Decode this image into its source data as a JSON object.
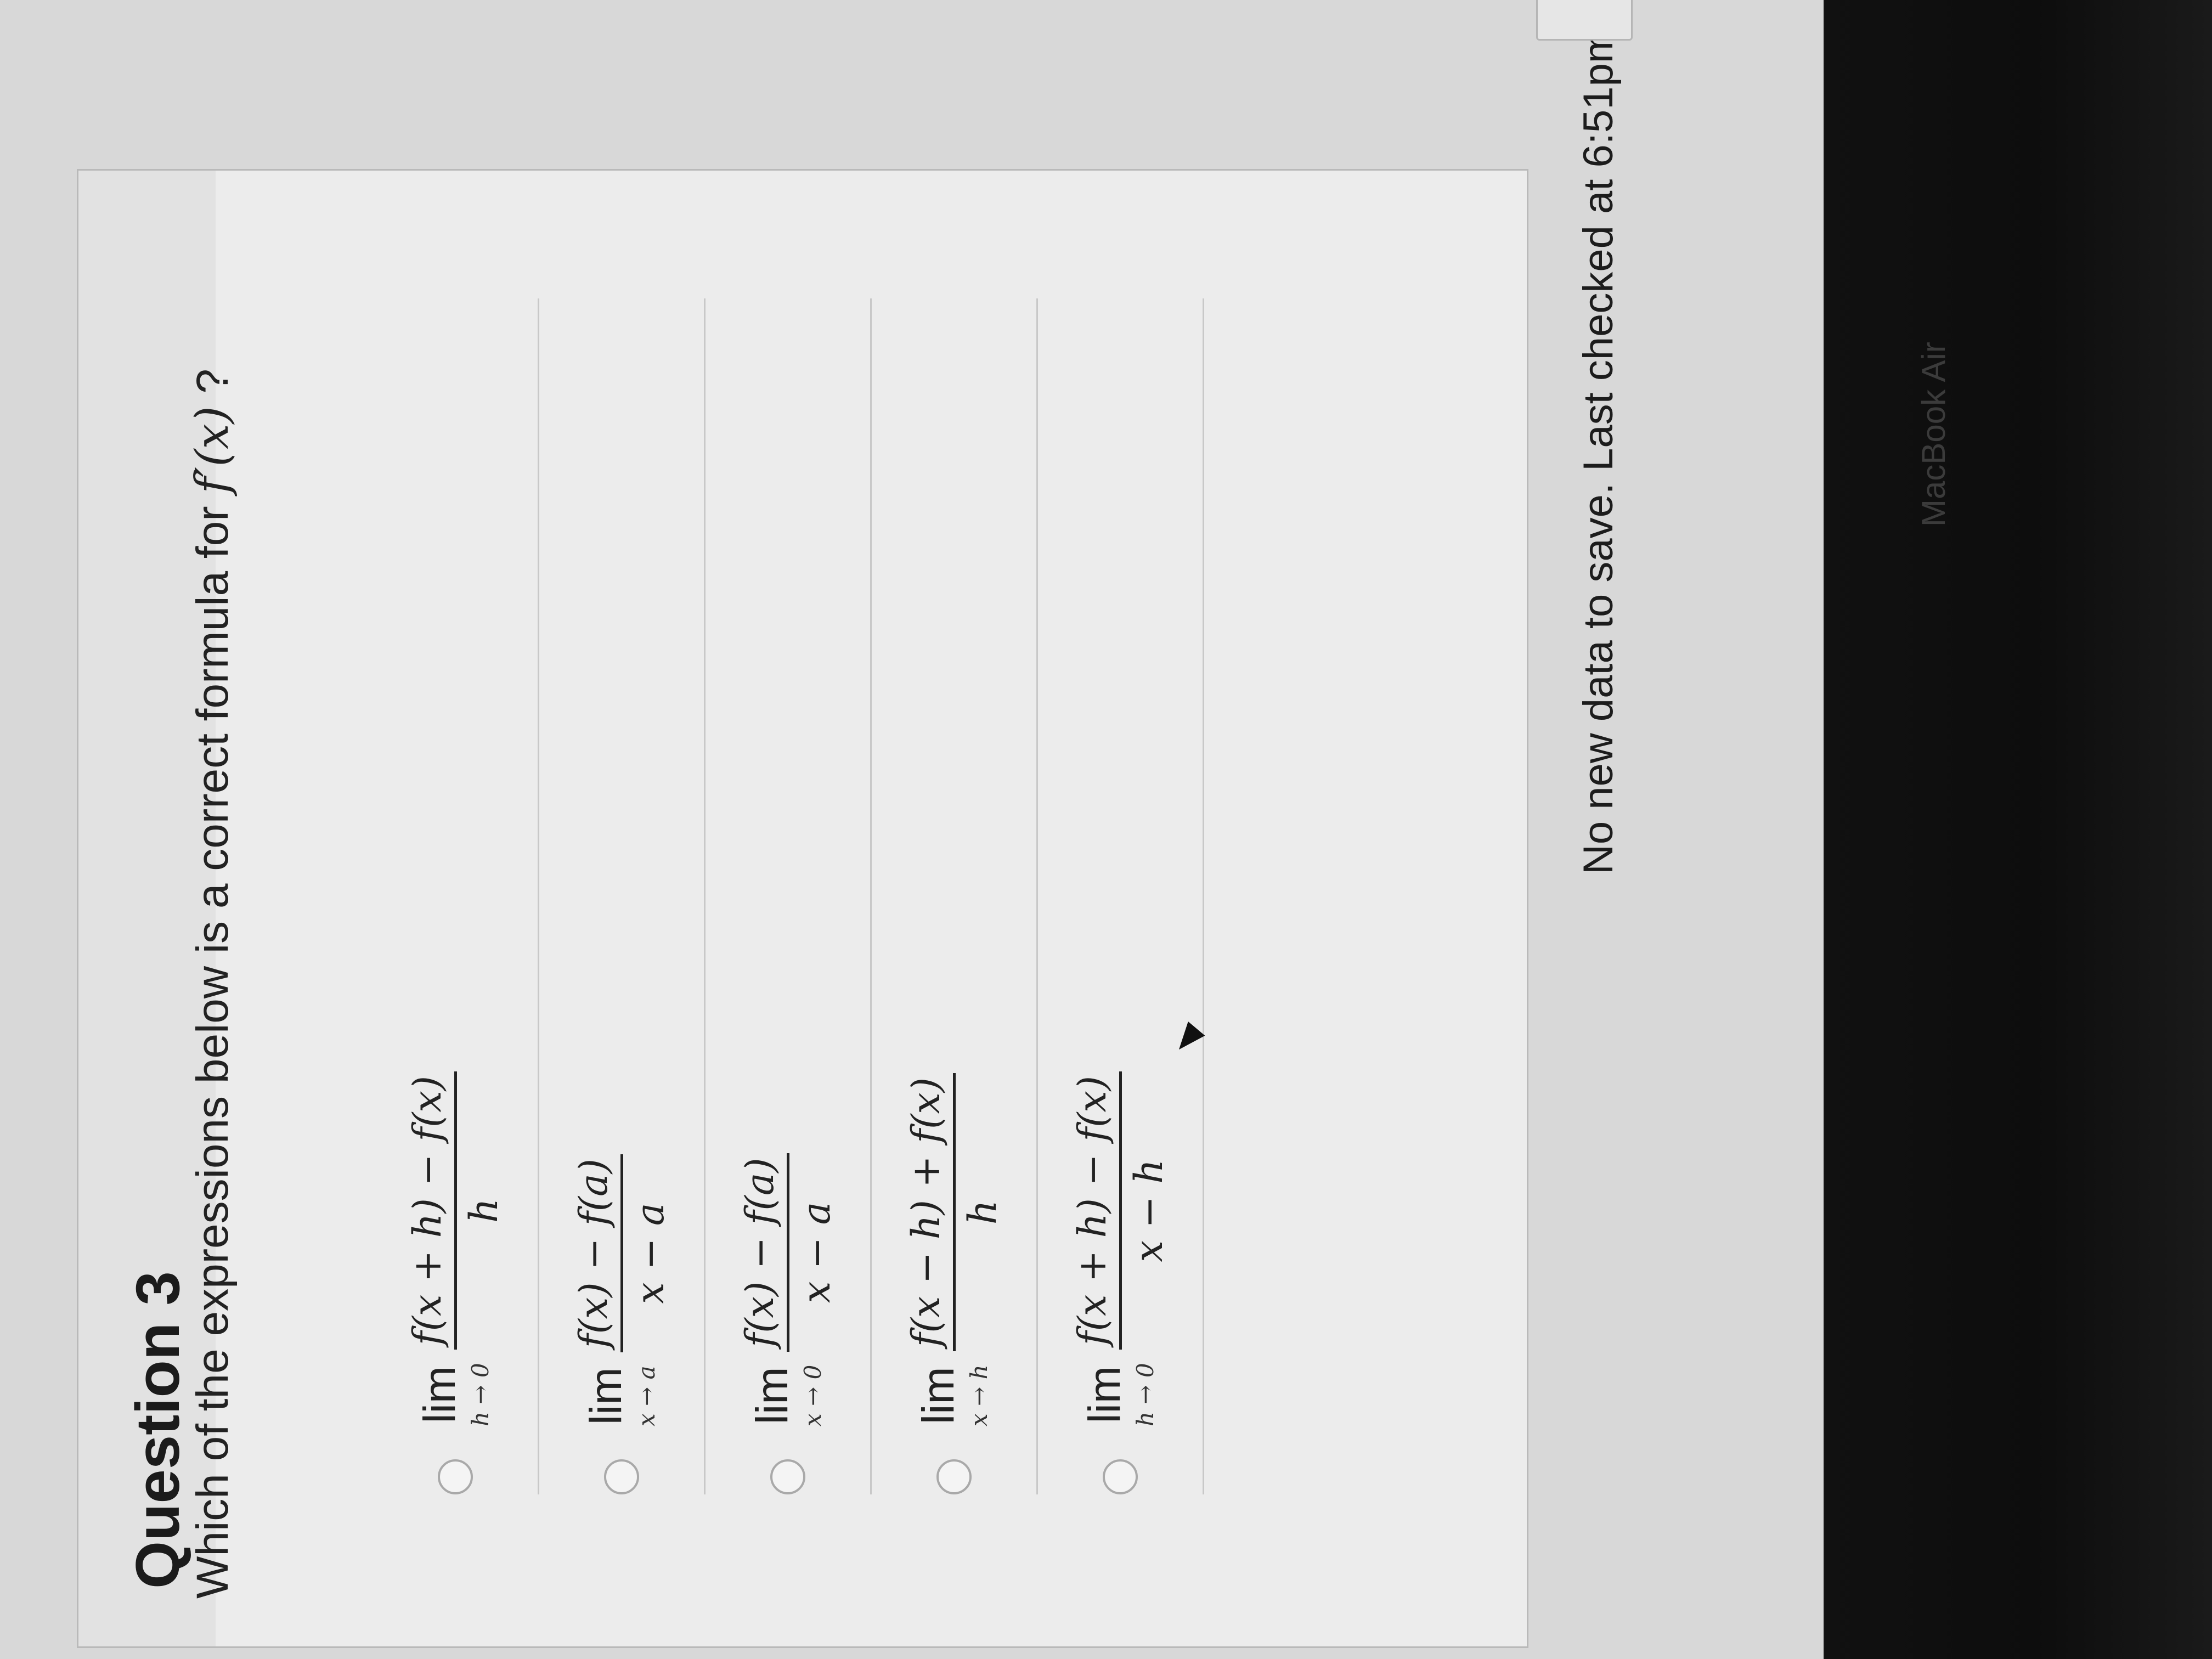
{
  "question": {
    "title": "Question 3",
    "prompt_text": "Which of the expressions below is a correct formula for ",
    "prompt_fx": "f′(x)",
    "prompt_end": " ?"
  },
  "options": [
    {
      "lim": "lim",
      "sub": "h → 0",
      "numerator": "f(x + h) − f(x)",
      "denominator": "h"
    },
    {
      "lim": "lim",
      "sub": "x → a",
      "numerator": "f(x) − f(a)",
      "denominator": "x − a"
    },
    {
      "lim": "lim",
      "sub": "x → 0",
      "numerator": "f(x) − f(a)",
      "denominator": "x − a"
    },
    {
      "lim": "lim",
      "sub": "x → h",
      "numerator": "f(x − h) + f(x)",
      "denominator": "h"
    },
    {
      "lim": "lim",
      "sub": "h → 0",
      "numerator": "f(x + h) − f(x)",
      "denominator": "x − h"
    }
  ],
  "status": {
    "text": "No new data to save. Last checked at 6:51pm"
  },
  "device": {
    "bezel_label": "MacBook Air"
  }
}
